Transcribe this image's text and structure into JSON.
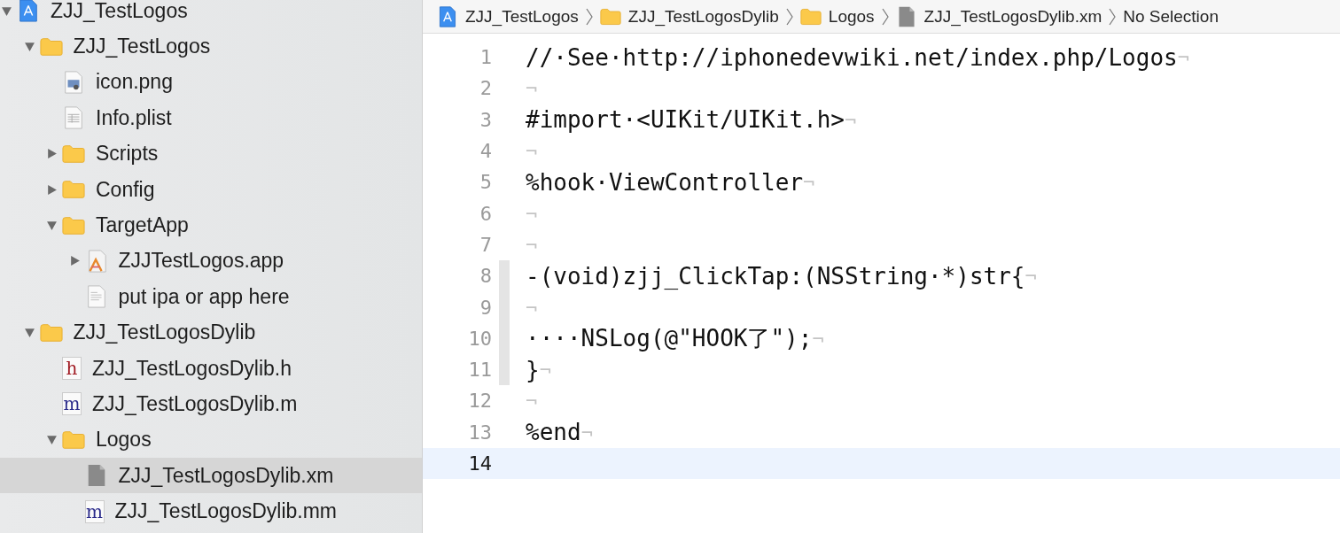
{
  "navigator": {
    "items": [
      {
        "label": "ZJJ_TestLogos",
        "kind": "project",
        "expanded": true,
        "selected": false,
        "children": [
          {
            "label": "ZJJ_TestLogos",
            "kind": "folder",
            "expanded": true,
            "selected": false,
            "children": [
              {
                "label": "icon.png",
                "kind": "image",
                "selected": false
              },
              {
                "label": "Info.plist",
                "kind": "plist",
                "selected": false
              },
              {
                "label": "Scripts",
                "kind": "folder",
                "expanded": false,
                "selected": false
              },
              {
                "label": "Config",
                "kind": "folder",
                "expanded": false,
                "selected": false
              },
              {
                "label": "TargetApp",
                "kind": "folder",
                "expanded": true,
                "selected": false,
                "children": [
                  {
                    "label": "ZJJTestLogos.app",
                    "kind": "app",
                    "expanded": false,
                    "selected": false
                  },
                  {
                    "label": "put ipa or app here",
                    "kind": "text",
                    "selected": false
                  }
                ]
              }
            ]
          },
          {
            "label": "ZJJ_TestLogosDylib",
            "kind": "folder",
            "expanded": true,
            "selected": false,
            "children": [
              {
                "label": "ZJJ_TestLogosDylib.h",
                "kind": "header",
                "letter": "h",
                "selected": false
              },
              {
                "label": "ZJJ_TestLogosDylib.m",
                "kind": "source",
                "letter": "m",
                "selected": false
              },
              {
                "label": "Logos",
                "kind": "folder",
                "expanded": true,
                "selected": false,
                "children": [
                  {
                    "label": "ZJJ_TestLogosDylib.xm",
                    "kind": "generic",
                    "selected": true
                  },
                  {
                    "label": "ZJJ_TestLogosDylib.mm",
                    "kind": "source",
                    "letter": "m",
                    "selected": false
                  }
                ]
              }
            ]
          }
        ]
      }
    ]
  },
  "breadcrumbs": [
    {
      "label": "ZJJ_TestLogos",
      "kind": "project"
    },
    {
      "label": "ZJJ_TestLogosDylib",
      "kind": "folder"
    },
    {
      "label": "Logos",
      "kind": "folder"
    },
    {
      "label": "ZJJ_TestLogosDylib.xm",
      "kind": "generic"
    },
    {
      "label": "No Selection"
    }
  ],
  "editor": {
    "lines": [
      {
        "number": "1",
        "text": "//·See·http://iphonedevwiki.net/index.php/Logos",
        "eol": "¬",
        "current": false,
        "change_bar": false
      },
      {
        "number": "2",
        "eol": "¬",
        "current": false,
        "change_bar": false
      },
      {
        "number": "3",
        "text": "#import·<UIKit/UIKit.h>",
        "eol": "¬",
        "current": false,
        "change_bar": false
      },
      {
        "number": "4",
        "eol": "¬",
        "current": false,
        "change_bar": false
      },
      {
        "number": "5",
        "text": "%hook·ViewController",
        "eol": "¬",
        "current": false,
        "change_bar": false
      },
      {
        "number": "6",
        "eol": "¬",
        "current": false,
        "change_bar": false
      },
      {
        "number": "7",
        "eol": "¬",
        "current": false,
        "change_bar": false
      },
      {
        "number": "8",
        "text": "-(void)zjj_ClickTap:(NSString·*)str{",
        "eol": "¬",
        "current": false,
        "change_bar": true
      },
      {
        "number": "9",
        "eol": "¬",
        "current": false,
        "change_bar": true
      },
      {
        "number": "10",
        "text": "····NSLog(@\"HOOK了\");",
        "eol": "¬",
        "current": false,
        "change_bar": true
      },
      {
        "number": "11",
        "text": "}",
        "eol": "¬",
        "current": false,
        "change_bar": true
      },
      {
        "number": "12",
        "eol": "¬",
        "current": false,
        "change_bar": false
      },
      {
        "number": "13",
        "text": "%end",
        "eol": "¬",
        "current": false,
        "change_bar": false
      },
      {
        "number": "14",
        "current": true,
        "change_bar": false
      }
    ]
  }
}
